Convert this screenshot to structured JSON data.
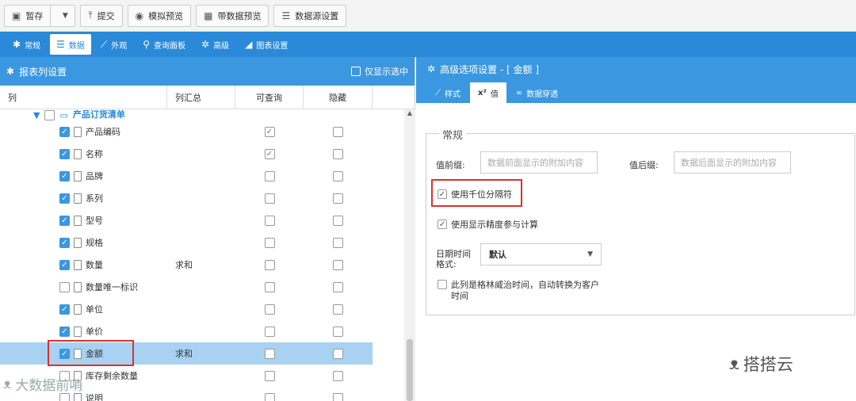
{
  "toolbar": {
    "save": "暂存",
    "submit": "提交",
    "mock_preview": "模拟预览",
    "data_preview": "带数据预览",
    "datasource": "数据源设置"
  },
  "tabs": [
    {
      "label": "常规"
    },
    {
      "label": "数据"
    },
    {
      "label": "外观"
    },
    {
      "label": "查询面板"
    },
    {
      "label": "高级"
    },
    {
      "label": "图表设置"
    }
  ],
  "left_panel": {
    "title": "报表列设置",
    "only_selected": "仅显示选中",
    "columns": [
      "列",
      "列汇总",
      "可查询",
      "隐藏"
    ],
    "group": "产品订货清单",
    "rows": [
      {
        "name": "产品编码",
        "checked": true,
        "sum": "",
        "queryable": true,
        "hidden": false
      },
      {
        "name": "名称",
        "checked": true,
        "sum": "",
        "queryable": true,
        "hidden": false
      },
      {
        "name": "品牌",
        "checked": true,
        "sum": "",
        "queryable": false,
        "hidden": false
      },
      {
        "name": "系列",
        "checked": true,
        "sum": "",
        "queryable": false,
        "hidden": false
      },
      {
        "name": "型号",
        "checked": true,
        "sum": "",
        "queryable": false,
        "hidden": false
      },
      {
        "name": "规格",
        "checked": true,
        "sum": "",
        "queryable": false,
        "hidden": false
      },
      {
        "name": "数量",
        "checked": true,
        "sum": "求和",
        "queryable": false,
        "hidden": false
      },
      {
        "name": "数量唯一标识",
        "checked": false,
        "sum": "",
        "queryable": false,
        "hidden": false
      },
      {
        "name": "单位",
        "checked": true,
        "sum": "",
        "queryable": false,
        "hidden": false
      },
      {
        "name": "单价",
        "checked": true,
        "sum": "",
        "queryable": false,
        "hidden": false
      },
      {
        "name": "金额",
        "checked": true,
        "sum": "求和",
        "queryable": false,
        "hidden": false,
        "selected": true
      },
      {
        "name": "库存剩余数量",
        "checked": false,
        "sum": "",
        "queryable": false,
        "hidden": false
      },
      {
        "name": "说明",
        "checked": false,
        "sum": "",
        "queryable": false,
        "hidden": false
      }
    ]
  },
  "right_panel": {
    "title": "高级选项设置 - [ 金额 ]",
    "tabs": [
      "样式",
      "值",
      "数据穿透"
    ],
    "value_tab_sup": "x²",
    "section": "常规",
    "prefix_label": "值前缀:",
    "prefix_placeholder": "数据前面显示的附加内容",
    "suffix_label": "值后缀:",
    "suffix_placeholder": "数据后面显示的附加内容",
    "thousands_sep": "使用千位分隔符",
    "precision_calc": "使用显示精度参与计算",
    "datetime_label_1": "日期时间",
    "datetime_label_2": "格式:",
    "datetime_value": "默认",
    "gmt_1": "此列是格林威治时间，自动转换为客户",
    "gmt_2": "时间"
  },
  "watermarks": {
    "left": "大数据前哨",
    "right": "搭搭云"
  }
}
